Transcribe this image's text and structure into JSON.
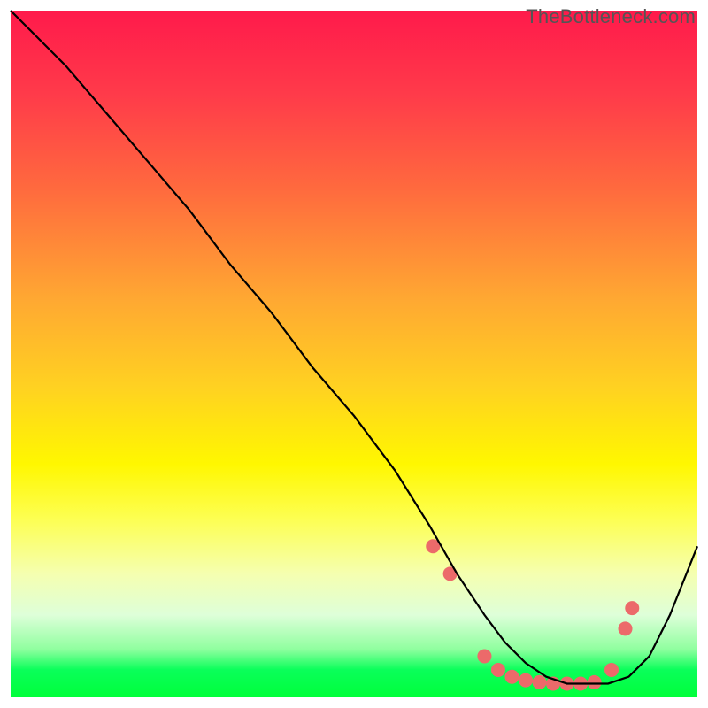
{
  "watermark": "TheBottleneck.com",
  "chart_data": {
    "type": "line",
    "title": "",
    "xlabel": "",
    "ylabel": "",
    "xlim": [
      0,
      100
    ],
    "ylim": [
      0,
      100
    ],
    "series": [
      {
        "name": "bottleneck-curve",
        "x": [
          0,
          3,
          8,
          14,
          20,
          26,
          32,
          38,
          44,
          50,
          56,
          61,
          65,
          69,
          72,
          75,
          78,
          81,
          84,
          87,
          90,
          93,
          96,
          100
        ],
        "y": [
          100,
          97,
          92,
          85,
          78,
          71,
          63,
          56,
          48,
          41,
          33,
          25,
          18,
          12,
          8,
          5,
          3,
          2,
          2,
          2,
          3,
          6,
          12,
          22
        ]
      }
    ],
    "markers": {
      "name": "highlighted-points",
      "color": "#ec6a6a",
      "radius_px": 8,
      "x": [
        61.5,
        64,
        69,
        71,
        73,
        75,
        77,
        79,
        81,
        83,
        85,
        87.5,
        89.5,
        90.5
      ],
      "y": [
        22,
        18,
        6,
        4,
        3,
        2.5,
        2.2,
        2,
        2,
        2,
        2.2,
        4,
        10,
        13
      ]
    }
  },
  "colors": {
    "curve": "#000000",
    "marker": "#ec6a6a"
  }
}
